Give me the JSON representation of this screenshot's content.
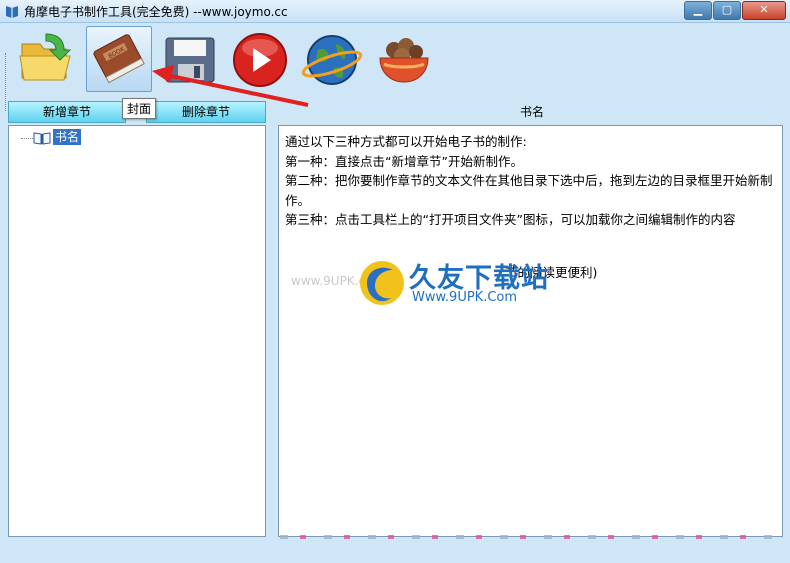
{
  "window": {
    "title": "角摩电子书制作工具(完全免费) --www.joymo.cc",
    "minimize_label": "▁",
    "maximize_label": "▢",
    "close_label": "✕"
  },
  "toolbar": {
    "tools": [
      {
        "icon": "open-folder-icon"
      },
      {
        "icon": "book-cover-icon"
      },
      {
        "icon": "save-disk-icon"
      },
      {
        "icon": "play-icon"
      },
      {
        "icon": "globe-icon"
      },
      {
        "icon": "bowl-icon"
      }
    ],
    "tooltip": "封面"
  },
  "tabs": {
    "add_chapter": "新增章节",
    "delete_chapter": "删除章节",
    "panel_title": "书名"
  },
  "tree": {
    "root_label": "书名"
  },
  "content": {
    "lines": [
      "通过以下三种方式都可以开始电子书的制作:",
      "第一种：直接点击“新增章节”开始新制作。",
      "第二种：把你要制作章节的文本文件在其他目录下选中后，拖到左边的目录框里开始新制作。",
      "第三种：点击工具栏上的“打开项目文件夹”图标，可以加载你之间编辑制作的内容"
    ],
    "partial_line": "节的阅读更便利)"
  },
  "watermark": {
    "brand": "久友下载站",
    "brand_url": "Www.9UPK.Com",
    "faded_url": "www.9UPK.com"
  },
  "colors": {
    "background": "#cfe6f7",
    "tab_fill": "#5fd2ef",
    "selection": "#3173c8",
    "arrow": "#e0211f"
  }
}
